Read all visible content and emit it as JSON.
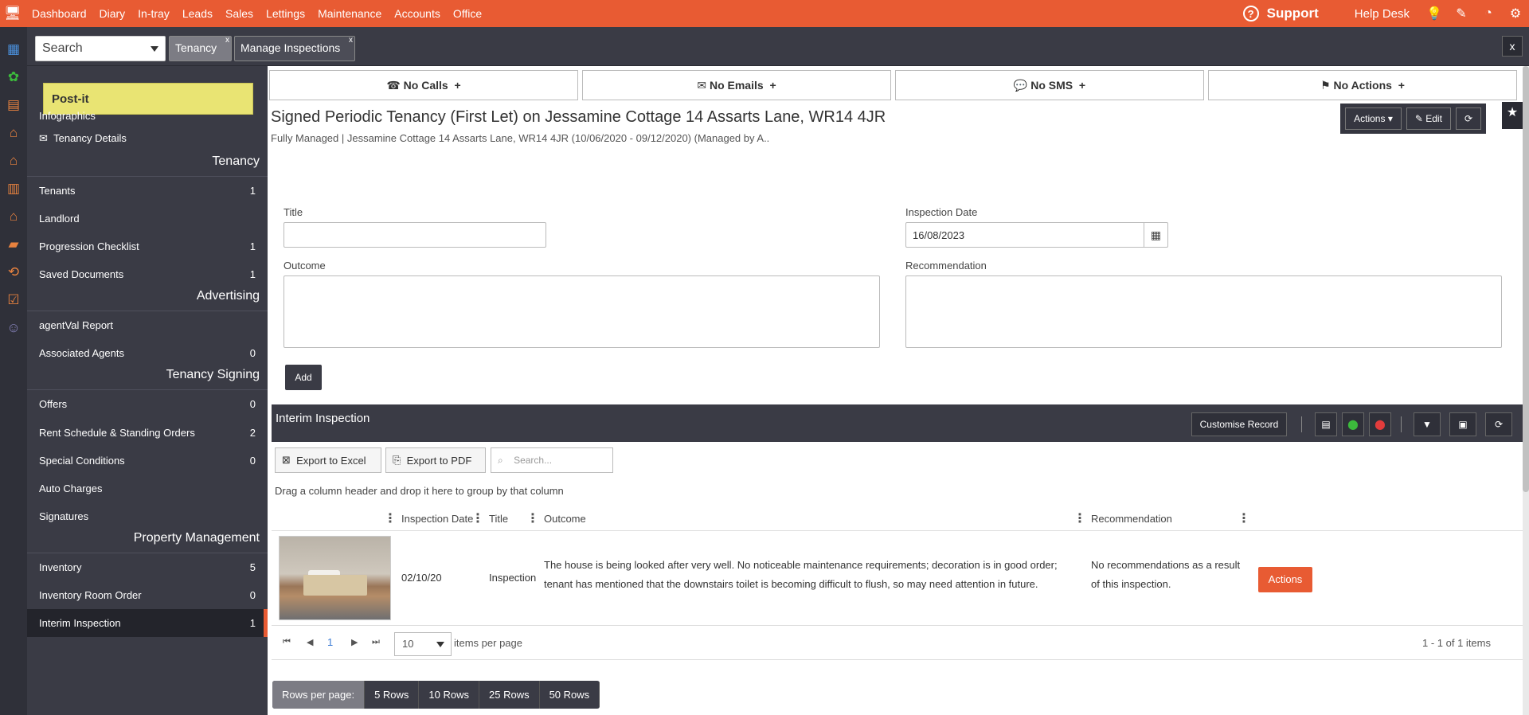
{
  "topnav": {
    "items": [
      "Dashboard",
      "Diary",
      "In-tray",
      "Leads",
      "Sales",
      "Lettings",
      "Maintenance",
      "Accounts",
      "Office"
    ],
    "support": "Support",
    "helpdesk": "Help Desk",
    "icons": [
      "lightbulb-icon",
      "edit-icon",
      "speedometer-icon",
      "gear-icon"
    ]
  },
  "toolbar": {
    "search_value": "Search",
    "tabs": [
      {
        "label": "Tenancy",
        "close": "x"
      },
      {
        "label": "Manage Inspections",
        "close": "x"
      }
    ],
    "close_all": "x"
  },
  "sidebar": {
    "postit": "Post-it",
    "links": [
      "Infographics",
      "Tenancy Details"
    ],
    "sections": [
      {
        "heading": "Tenancy",
        "items": [
          {
            "label": "Tenants",
            "count": "1"
          },
          {
            "label": "Landlord",
            "count": ""
          },
          {
            "label": "Progression Checklist",
            "count": "1"
          },
          {
            "label": "Saved Documents",
            "count": "1"
          }
        ]
      },
      {
        "heading": "Advertising",
        "items": [
          {
            "label": "agentVal Report",
            "count": ""
          },
          {
            "label": "Associated Agents",
            "count": "0"
          }
        ]
      },
      {
        "heading": "Tenancy Signing",
        "items": [
          {
            "label": "Offers",
            "count": "0"
          },
          {
            "label": "Rent Schedule & Standing Orders",
            "count": "2"
          },
          {
            "label": "Special Conditions",
            "count": "0"
          },
          {
            "label": "Auto Charges",
            "count": ""
          },
          {
            "label": "Signatures",
            "count": ""
          }
        ]
      },
      {
        "heading": "Property Management",
        "items": [
          {
            "label": "Inventory",
            "count": "5"
          },
          {
            "label": "Inventory Room Order",
            "count": "0"
          },
          {
            "label": "Interim Inspection",
            "count": "1"
          }
        ]
      }
    ]
  },
  "comms": [
    {
      "icon": "phone-icon",
      "label": "No Calls",
      "plus": "+"
    },
    {
      "icon": "envelope-icon",
      "label": "No Emails",
      "plus": "+"
    },
    {
      "icon": "chat-icon",
      "label": "No SMS",
      "plus": "+"
    },
    {
      "icon": "flag-icon",
      "label": "No Actions",
      "plus": "+"
    }
  ],
  "page": {
    "title": "Signed Periodic Tenancy (First Let) on Jessamine Cottage 14 Assarts Lane, WR14 4JR",
    "subtitle": "Fully Managed | Jessamine Cottage 14 Assarts Lane, WR14 4JR (10/06/2020 - 09/12/2020) (Managed by A..",
    "actions": "Actions",
    "edit": "Edit"
  },
  "form": {
    "title_label": "Title",
    "title_value": "",
    "inspection_date_label": "Inspection Date",
    "inspection_date_value": "16/08/2023",
    "outcome_label": "Outcome",
    "recommendation_label": "Recommendation",
    "add": "Add"
  },
  "grid": {
    "title": "Interim Inspection",
    "customise": "Customise Record",
    "export_excel": "Export to Excel",
    "export_pdf": "Export to PDF",
    "search_placeholder": "Search...",
    "group_hint": "Drag a column header and drop it here to group by that column",
    "columns": [
      "Inspection Date",
      "Title",
      "Outcome",
      "Recommendation"
    ],
    "rows": [
      {
        "inspection_date": "02/10/20",
        "title": "Inspection",
        "outcome": "The house is being looked after very well. No noticeable maintenance requirements; decoration is in good order; tenant has mentioned that the downstairs toilet is becoming difficult to flush, so may need attention in future.",
        "recommendation": "No recommendations as a result of this inspection.",
        "action": "Actions"
      }
    ],
    "pager": {
      "page": "1",
      "page_size": "10",
      "items_per_page": "items per page",
      "summary": "1 - 1 of 1 items"
    }
  },
  "rows_per_page": {
    "label": "Rows per page:",
    "options": [
      "5 Rows",
      "10 Rows",
      "25 Rows",
      "50 Rows"
    ]
  }
}
